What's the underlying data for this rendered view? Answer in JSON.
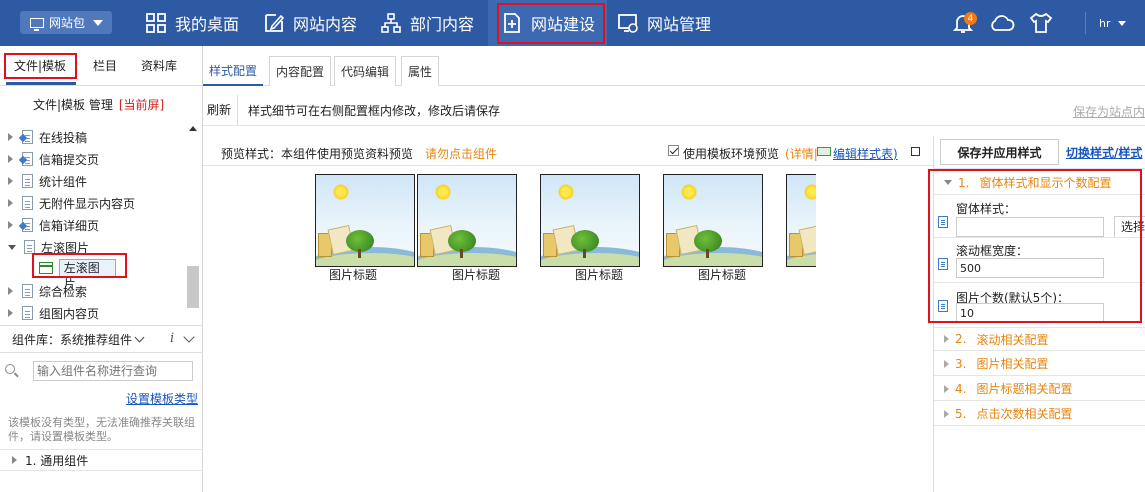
{
  "top": {
    "site_button": "网站包",
    "nav": [
      {
        "label": "我的桌面"
      },
      {
        "label": "网站内容"
      },
      {
        "label": "部门内容"
      },
      {
        "label": "网站建设"
      },
      {
        "label": "网站管理"
      }
    ],
    "notification_count": "4",
    "user": "hr"
  },
  "left": {
    "tabs": [
      "文件|模板",
      "栏目",
      "资料库"
    ],
    "header": "文件|模板 管理",
    "header_current": "[当前屏]",
    "tree": [
      {
        "label": "在线投稿"
      },
      {
        "label": "信箱提交页"
      },
      {
        "label": "统计组件"
      },
      {
        "label": "无附件显示内容页"
      },
      {
        "label": "信箱详细页"
      },
      {
        "label": "左滚图片"
      },
      {
        "label": "综合检索"
      },
      {
        "label": "组图内容页"
      }
    ],
    "selected_child": "左滚图片",
    "component_lib": "组件库：系统推荐组件",
    "info_symbol": "i",
    "search_placeholder": "输入组件名称进行查询",
    "set_type_link": "设置模板类型",
    "note": "该模板没有类型，无法准确推荐关联组件，请设置模板类型。",
    "group": "1.  通用组件"
  },
  "center": {
    "tabs": [
      "样式配置",
      "内容配置",
      "代码编辑",
      "属性"
    ],
    "refresh": "刷新",
    "toolbar_msg": "样式细节可在右侧配置框内修改，修改后请保存",
    "save_to_site": "保存为站点内",
    "preview_label": "预览样式：本组件使用预览资料预览",
    "preview_warn": "请勿点击组件",
    "use_template_preview": "使用模板环境预览",
    "detail_open": "(",
    "detail": "详情",
    "detail_sep": "|",
    "edit_style": "编辑样式表",
    "detail_close": ")",
    "pictures": [
      {
        "caption": "图片标题"
      },
      {
        "caption": "图片标题"
      },
      {
        "caption": "图片标题"
      },
      {
        "caption": "图片标题"
      },
      {
        "caption": ""
      }
    ]
  },
  "right": {
    "save_apply": "保存并应用样式",
    "switch_style": "切换样式/样式",
    "sections": [
      {
        "num": "1.",
        "label": "窗体样式和显示个数配置"
      },
      {
        "num": "2.",
        "label": "滚动相关配置"
      },
      {
        "num": "3.",
        "label": "图片相关配置"
      },
      {
        "num": "4.",
        "label": "图片标题相关配置"
      },
      {
        "num": "5.",
        "label": "点击次数相关配置"
      }
    ],
    "fields": {
      "form_style_label": "窗体样式：",
      "form_style_value": "",
      "select_button": "选择",
      "scroll_width_label": "滚动框宽度：",
      "scroll_width_value": "500",
      "pic_count_label": "图片个数(默认5个)：",
      "pic_count_value": "10"
    }
  },
  "colors": {
    "topbar": "#2e5aa3",
    "accent_orange": "#e6850e",
    "link_blue": "#1a55c0",
    "highlight_red": "#e0101c"
  }
}
